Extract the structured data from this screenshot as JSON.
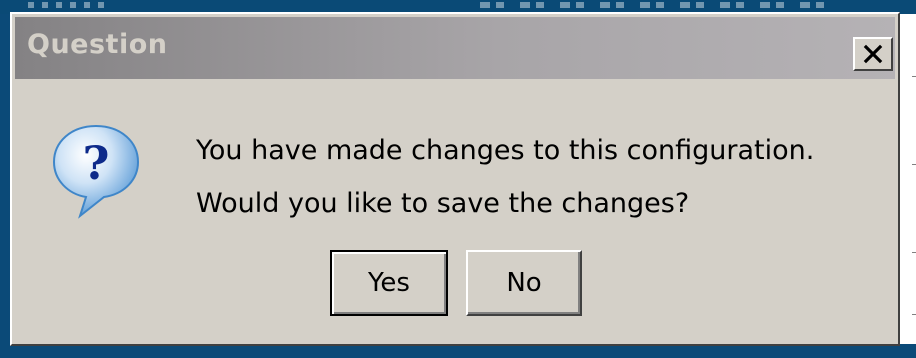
{
  "dialog": {
    "title": "Question",
    "close_label": "X",
    "icon": "question-icon",
    "message_line1": "You have made changes to this configuration.",
    "message_line2": "Would you like to save the changes?",
    "buttons": {
      "yes": "Yes",
      "no": "No",
      "default": "yes"
    }
  },
  "colors": {
    "desktop_background": "#0b4a78",
    "dialog_face": "#d4d0c8",
    "titlebar_inactive_start": "#848284",
    "titlebar_inactive_end": "#b5b2b5",
    "title_text": "#d4d0c8",
    "icon_blue": "#3f86c9"
  }
}
